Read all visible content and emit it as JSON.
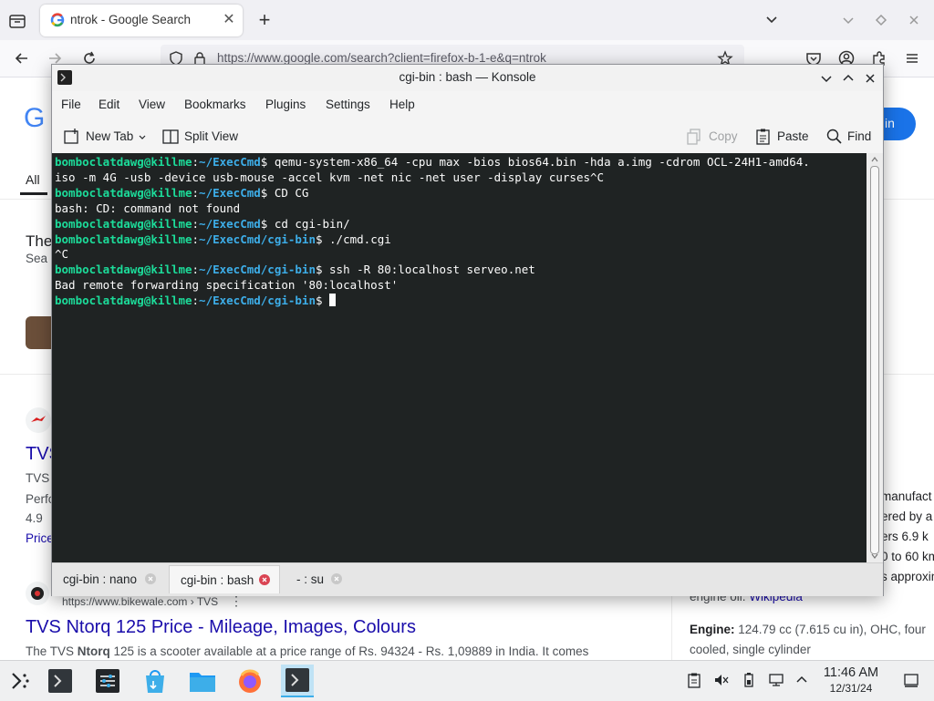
{
  "firefox": {
    "tab_title": "ntrok - Google Search",
    "new_tab_glyph": "+",
    "close_glyph": "✕",
    "url": "https://www.google.com/search?client=firefox-b-1-e&q=ntrok"
  },
  "google": {
    "logo_partial": "G",
    "tab_all": "All",
    "sign_in": "in",
    "left_fragments": {
      "the": "The",
      "sea": "Sea",
      "tvs": "TVS",
      "tvs_small": "TVS",
      "perf": "Perfo",
      "rating": "4.9",
      "price": "Price"
    },
    "right_fragments": {
      "e": "e",
      "manufact": "manufact",
      "ered": "ered by a",
      "ers": "ers 6.9 k",
      "km": "0 to 60 km",
      "approx": "s approxin"
    },
    "result2": {
      "breadcrumb": "https://www.bikewale.com › TVS",
      "title": "TVS Ntorq 125 Price - Mileage, Images, Colours",
      "snippet_pre": "The TVS ",
      "snippet_bold": "Ntorq",
      "snippet_post": " 125 is a scooter available at a price range of Rs. 94324 - Rs. 1,09889 in India. It comes"
    },
    "panel": {
      "source_text": "engine oil. ",
      "source_link": "Wikipedia",
      "engine_label": "Engine:",
      "engine_value": " 124.79 cc (7.615 cu in), OHC, four",
      "engine_value2": "cooled, single cylinder"
    }
  },
  "konsole": {
    "title": "cgi-bin : bash — Konsole",
    "menu": [
      "File",
      "Edit",
      "View",
      "Bookmarks",
      "Plugins",
      "Settings",
      "Help"
    ],
    "toolbar": {
      "new_tab": "New Tab",
      "split_view": "Split View",
      "copy": "Copy",
      "paste": "Paste",
      "find": "Find"
    },
    "terminal": {
      "user": "bomboclatdawg@killme",
      "path_execcmd": "~/ExecCmd",
      "path_cgibin": "~/ExecCmd/cgi-bin",
      "cmd1": "$ qemu-system-x86_64 -cpu max -bios bios64.bin -hda a.img -cdrom OCL-24H1-amd64.",
      "cmd1_cont": "iso -m 4G -usb -device usb-mouse -accel kvm -net nic -net user -display curses^C",
      "cmd2": "$ CD CG",
      "out2": "bash: CD: command not found",
      "cmd3": "$ cd cgi-bin/",
      "cmd4": "$ ./cmd.cgi",
      "out4": "^C",
      "cmd5": "$ ssh -R 80:localhost serveo.net",
      "out5": "Bad remote forwarding specification '80:localhost'",
      "cmd6": "$ "
    },
    "tabs": [
      {
        "label": "cgi-bin : nano"
      },
      {
        "label": "cgi-bin : bash"
      },
      {
        "label": "- : su"
      }
    ]
  },
  "taskbar": {
    "time": "11:46 AM",
    "date": "12/31/24"
  },
  "colors": {
    "terminal_bg": "#1f2323",
    "prompt_user": "#1cdc9a",
    "prompt_path": "#3daee9",
    "google_link": "#1a0dab",
    "google_blue": "#1a73e8"
  }
}
